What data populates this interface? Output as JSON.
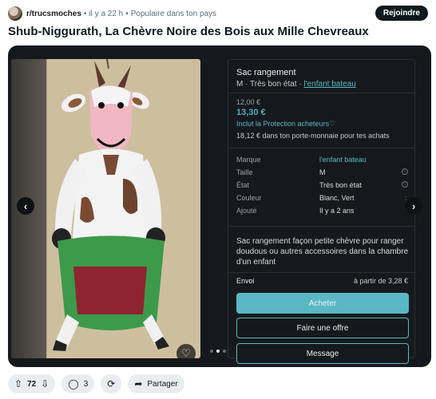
{
  "header": {
    "subreddit": "r/trucsmoches",
    "separator": "•",
    "time": "il y a 22 h",
    "popular": "Populaire dans ton pays",
    "join_label": "Rejoindre"
  },
  "post": {
    "title": "Shub-Niggurath, La Chèvre Noire des Bois aux Mille Chevreaux"
  },
  "listing": {
    "title": "Sac rangement",
    "size_condition": "M · Très bon état ·",
    "brand_link": "l'enfant bateau",
    "price_old": "12,00 €",
    "price": "13,30 €",
    "protection": "Inclut la Protection acheteurs",
    "wallet_note": "18,12 € dans ton porte-monnaie pour tes achats",
    "details": [
      {
        "key": "Marque",
        "value": "l'enfant bateau"
      },
      {
        "key": "Taille",
        "value": "M"
      },
      {
        "key": "État",
        "value": "Très bon état"
      },
      {
        "key": "Couleur",
        "value": "Blanc, Vert"
      },
      {
        "key": "Ajouté",
        "value": "Il y a 2 ans"
      }
    ],
    "description": "Sac rangement façon petite chèvre pour ranger doudous ou autres accessoires dans la chambre d'un enfant",
    "shipping_label": "Envoi",
    "shipping_value": "à partir de 3,28 €",
    "buy_label": "Acheter",
    "offer_label": "Faire une offre",
    "message_label": "Message"
  },
  "carousel": {
    "slide_count": 3,
    "active_index": 1,
    "prev_icon": "chevron-left-icon",
    "next_icon": "chevron-right-icon"
  },
  "actions": {
    "votes": "72",
    "comments": "3",
    "share_label": "Partager"
  },
  "colors": {
    "accent": "#5bb7c3",
    "panel_bg": "#15191d",
    "join_bg": "#0f1a1c"
  }
}
